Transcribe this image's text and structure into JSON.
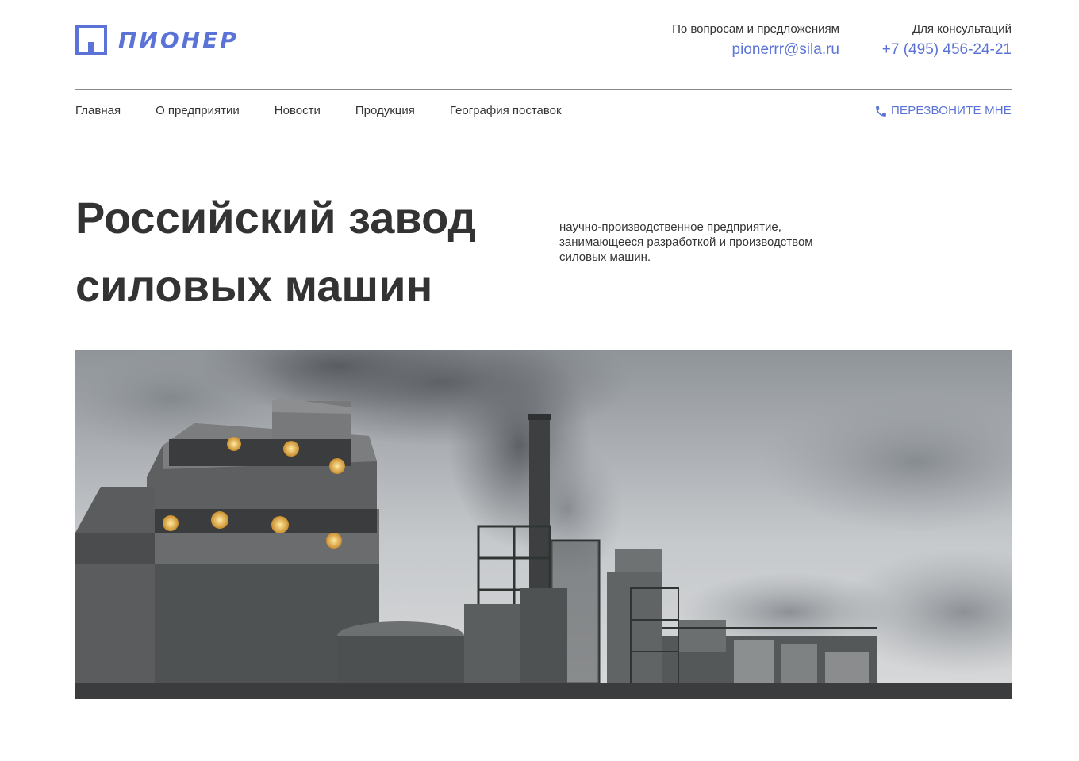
{
  "brand": {
    "name": "ПИОНЕР",
    "accent_color": "#5b73d6"
  },
  "contacts": [
    {
      "caption": "По вопросам и предложениям",
      "value": "pionerrr@sila.ru"
    },
    {
      "caption": "Для консультаций",
      "value": "+7 (495) 456-24-21"
    }
  ],
  "nav": {
    "items": [
      "Главная",
      "О предприятии",
      "Новости",
      "Продукция",
      "География поставок"
    ],
    "callback": {
      "icon": "phone-icon",
      "label": "ПЕРЕЗВОНИТЕ МНЕ"
    }
  },
  "hero": {
    "title_line1": "Российский завод",
    "title_line2": "силовых машин",
    "description": "научно-производственное предприятие, занимающееся разработкой и производством силовых машин."
  }
}
